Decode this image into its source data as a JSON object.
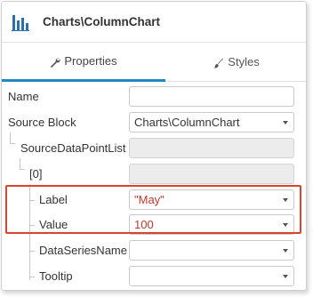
{
  "header": {
    "title": "Charts\\ColumnChart",
    "icon": "column-chart-icon"
  },
  "tabs": [
    {
      "label": "Properties",
      "icon": "wrench-icon",
      "active": true
    },
    {
      "label": "Styles",
      "icon": "brush-icon",
      "active": false
    }
  ],
  "properties": {
    "name": {
      "label": "Name",
      "value": ""
    },
    "source_block": {
      "label": "Source Block",
      "value": "Charts\\ColumnChart"
    },
    "source_data_point_list": {
      "label": "SourceDataPointList",
      "value": ""
    },
    "index": {
      "label": "[0]",
      "value": ""
    },
    "item_label": {
      "label": "Label",
      "value": "\"May\""
    },
    "item_value": {
      "label": "Value",
      "value": "100"
    },
    "data_series_name": {
      "label": "DataSeriesName",
      "value": ""
    },
    "tooltip": {
      "label": "Tooltip",
      "value": ""
    }
  },
  "colors": {
    "accent": "#1e88c7",
    "highlight": "#d9452b",
    "value_text": "#c0392b"
  }
}
